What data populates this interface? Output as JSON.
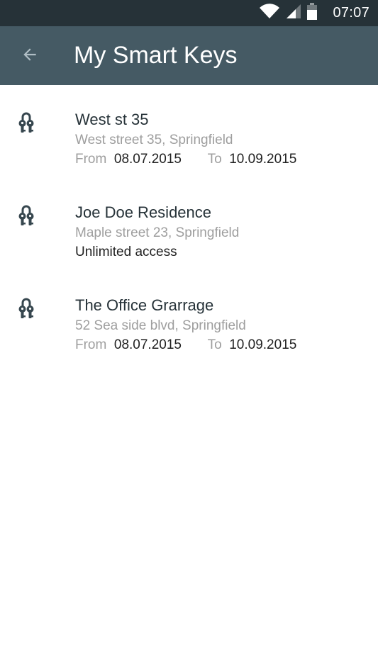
{
  "status_bar": {
    "time": "07:07",
    "icons": [
      "wifi-icon",
      "signal-icon",
      "battery-icon"
    ]
  },
  "app_bar": {
    "back_icon": "arrow-back-icon",
    "title": "My Smart Keys",
    "background": "#455a64"
  },
  "keys": [
    {
      "title": "West st 35",
      "address": "West street 35, Springfield",
      "from_label": "From",
      "from_date": "08.07.2015",
      "to_label": "To",
      "to_date": "10.09.2015"
    },
    {
      "title": "Joe Doe Residence",
      "address": "Maple street 23, Springfield",
      "access": "Unlimited access"
    },
    {
      "title": "The Office Grarrage",
      "address": "52 Sea side blvd, Springfield",
      "from_label": "From",
      "from_date": "08.07.2015",
      "to_label": "To",
      "to_date": "10.09.2015"
    }
  ],
  "icon": "keys-icon",
  "colors": {
    "status_bar": "#263238",
    "app_bar": "#455a64",
    "icon": "#37474f",
    "secondary_text": "#9e9e9e"
  }
}
